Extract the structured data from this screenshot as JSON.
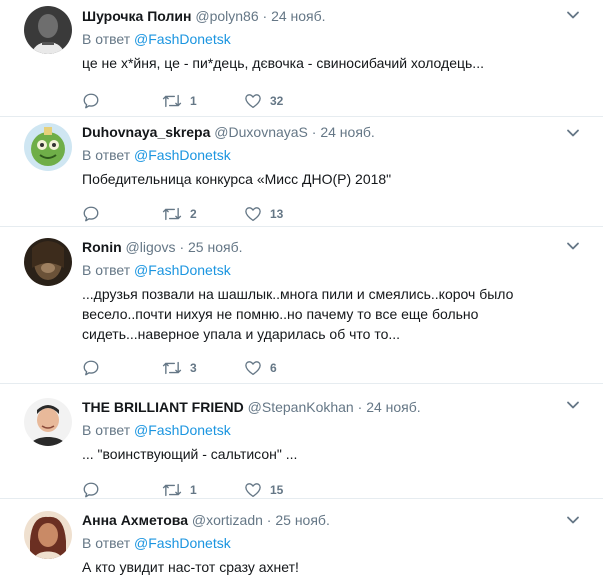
{
  "reply_prefix": "В ответ",
  "reply_target": "@FashDonetsk",
  "tweets": [
    {
      "name": "Шурочка Полин",
      "handle": "@polyn86",
      "dot": "·",
      "date": "24 нояб.",
      "text": "це не х*йня, це - пи*дець, дєвочка - свиносибачий холодець...",
      "retweets": "1",
      "likes": "32",
      "avatar_colors": [
        "#2b2b2b",
        "#6a6a6a",
        "#e9e9e9"
      ]
    },
    {
      "name": "Duhovnaya_skrepa",
      "handle": "@DuxovnayaS",
      "dot": "·",
      "date": "24 нояб.",
      "text": "Победительница конкурса «Мисс ДНО(Р) 2018\"",
      "retweets": "2",
      "likes": "13",
      "avatar_colors": [
        "#5a8f3c",
        "#8fc45a",
        "#e6d07a"
      ]
    },
    {
      "name": "Ronin",
      "handle": "@ligovs",
      "dot": "·",
      "date": "25 нояб.",
      "text": "...друзья позвали на шашлык..многа пили и смеялись..короч было весело..почти нихуя не помню..но пачему то все еще больно сидеть...наверное упала и ударилась об что то...",
      "retweets": "3",
      "likes": "6",
      "avatar_colors": [
        "#2a2118",
        "#6b5238",
        "#9e8060"
      ]
    },
    {
      "name": "THE BRILLIANT FRIEND",
      "handle": "@StepanKokhan",
      "dot": "·",
      "date": "24 нояб.",
      "text": "... \"воинствующий - сальтисон\" ...",
      "retweets": "1",
      "likes": "15",
      "avatar_colors": [
        "#f2f2f2",
        "#2a2a2a",
        "#e8b99a"
      ]
    },
    {
      "name": "Анна Ахметова",
      "handle": "@xortizadn",
      "dot": "·",
      "date": "25 нояб.",
      "text": "А кто увидит нас-тот сразу ахнет!",
      "avatar_colors": [
        "#6b2f22",
        "#c98a66",
        "#efe0cf"
      ]
    }
  ]
}
